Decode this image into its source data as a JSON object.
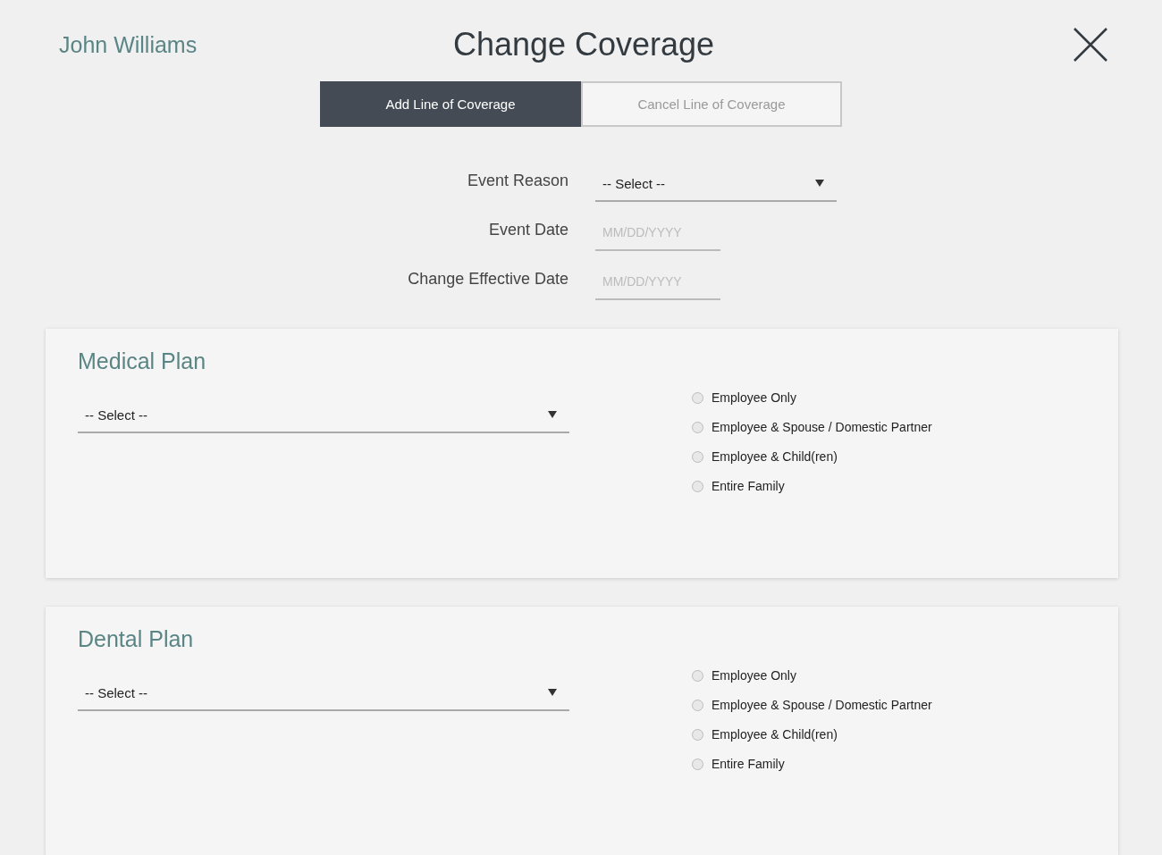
{
  "user_name": "John Williams",
  "title": "Change Coverage",
  "tabs": [
    {
      "label": "Add Line of Coverage",
      "selected": true
    },
    {
      "label": "Cancel Line of Coverage",
      "selected": false
    }
  ],
  "fields": [
    {
      "kind": "select",
      "label": "Event Reason",
      "value": "-- Select --"
    },
    {
      "kind": "date",
      "label": "Event Date",
      "placeholder": "MM/DD/YYYY"
    },
    {
      "kind": "date",
      "label": "Change Effective Date",
      "placeholder": "MM/DD/YYYY"
    }
  ],
  "plans": [
    {
      "title": "Medical Plan",
      "select": "-- Select --",
      "options": [
        {
          "label": "Employee Only",
          "selected": false
        },
        {
          "label": "Employee & Spouse / Domestic Partner",
          "selected": false
        },
        {
          "label": "Employee & Child(ren)",
          "selected": false
        },
        {
          "label": "Entire Family",
          "selected": false
        }
      ]
    },
    {
      "title": "Dental Plan",
      "select": "-- Select --",
      "options": [
        {
          "label": "Employee Only",
          "selected": false
        },
        {
          "label": "Employee & Spouse / Domestic Partner",
          "selected": false
        },
        {
          "label": "Employee & Child(ren)",
          "selected": false
        },
        {
          "label": "Entire Family",
          "selected": false
        }
      ]
    }
  ]
}
